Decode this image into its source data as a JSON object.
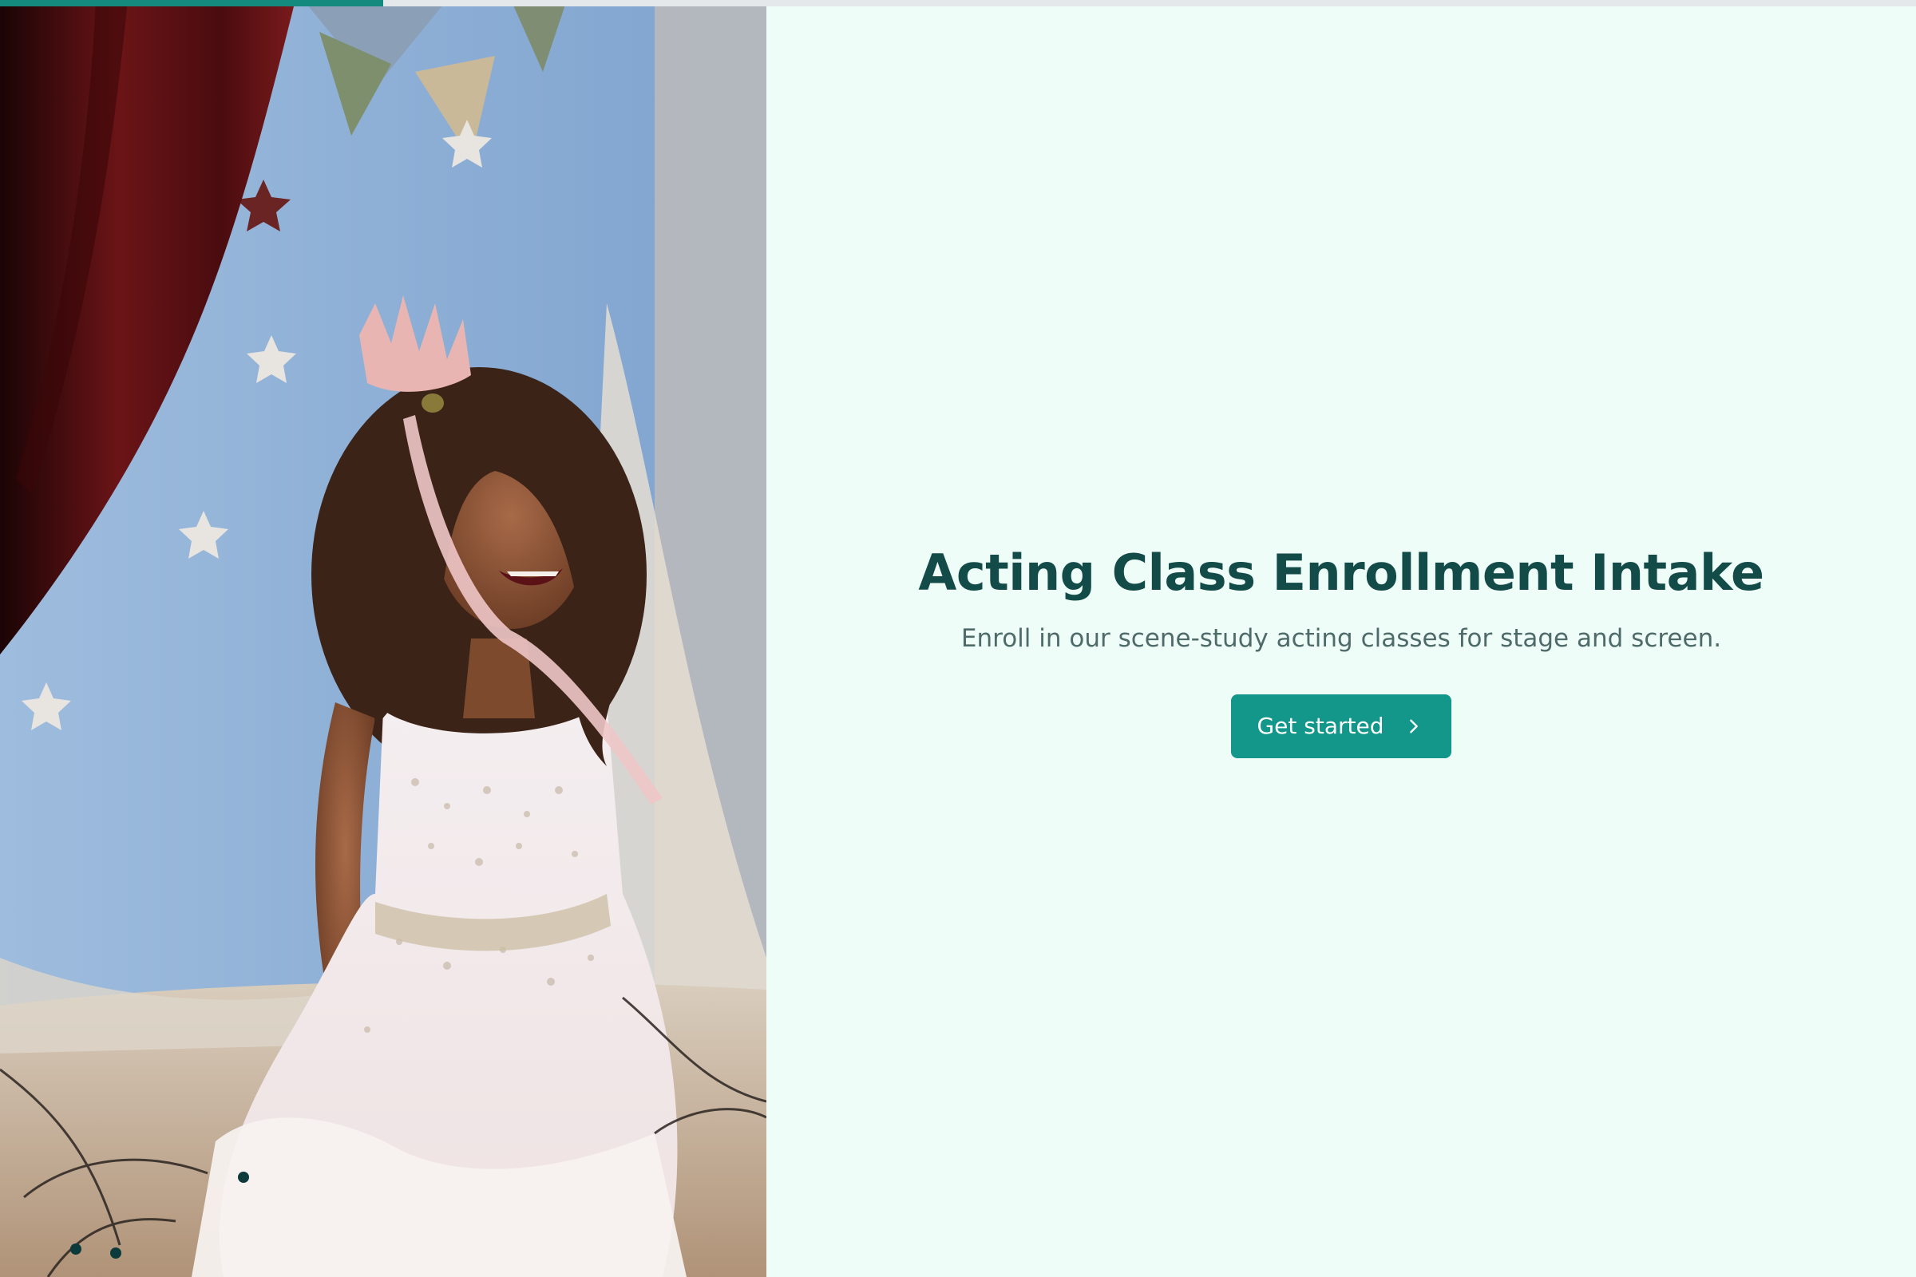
{
  "progress": {
    "fraction": 0.2
  },
  "hero": {
    "alt": "Child in sparkly dress and paper crown laughing on a stage with a blue star backdrop and red curtain",
    "icon": "hero-photo"
  },
  "intro": {
    "title": "Acting Class Enrollment Intake",
    "subtitle": "Enroll in our scene-study acting classes for stage and screen.",
    "cta_label": "Get started",
    "cta_icon": "chevron-right-icon"
  },
  "colors": {
    "accent": "#12978a",
    "title": "#124b47",
    "subtitle": "#4f6b69",
    "background": "#effdf9"
  }
}
